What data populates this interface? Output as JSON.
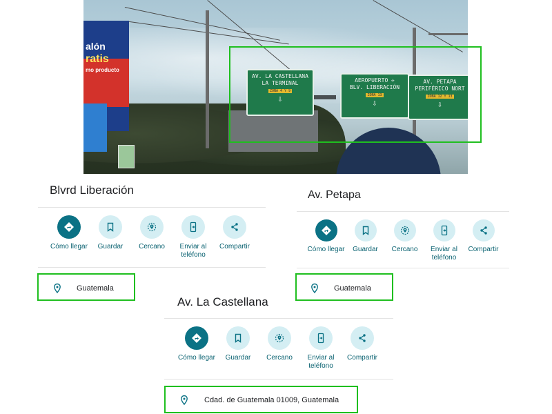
{
  "photo": {
    "billboard_lines": [
      "alón",
      "ratis",
      "mo producto"
    ],
    "signs": [
      {
        "lines": [
          "AV. LA CASTELLANA",
          "LA TERMINAL"
        ],
        "route": "ZONA 4 Y 9",
        "arrow": "⇩"
      },
      {
        "lines": [
          "AEROPUERTO ✈",
          "BLV. LIBERACIÓN"
        ],
        "route": "ZONA 13",
        "arrow": "⇩"
      },
      {
        "lines": [
          "AV. PETAPA",
          "PERIFÉRICO NORT"
        ],
        "route": "ZONA 12 Y 13",
        "arrow": "⇩"
      }
    ]
  },
  "cards": [
    {
      "title": "Blvrd Liberación",
      "location": "Guatemala"
    },
    {
      "title": "Av. Petapa",
      "location": "Guatemala"
    },
    {
      "title": "Av. La Castellana",
      "location": "Cdad. de Guatemala 01009, Guatemala"
    }
  ],
  "actions": {
    "directions": "Cómo llegar",
    "save": "Guardar",
    "nearby": "Cercano",
    "send": "Enviar al\nteléfono",
    "share": "Compartir"
  },
  "icons": [
    "directions-icon",
    "bookmark-icon",
    "nearby-icon",
    "send-to-phone-icon",
    "share-icon",
    "location-pin-icon"
  ],
  "colors": {
    "accent": "#0b7285",
    "action_bg": "#d4eef3",
    "label": "#0a6271",
    "highlight": "#1fbf1f"
  }
}
